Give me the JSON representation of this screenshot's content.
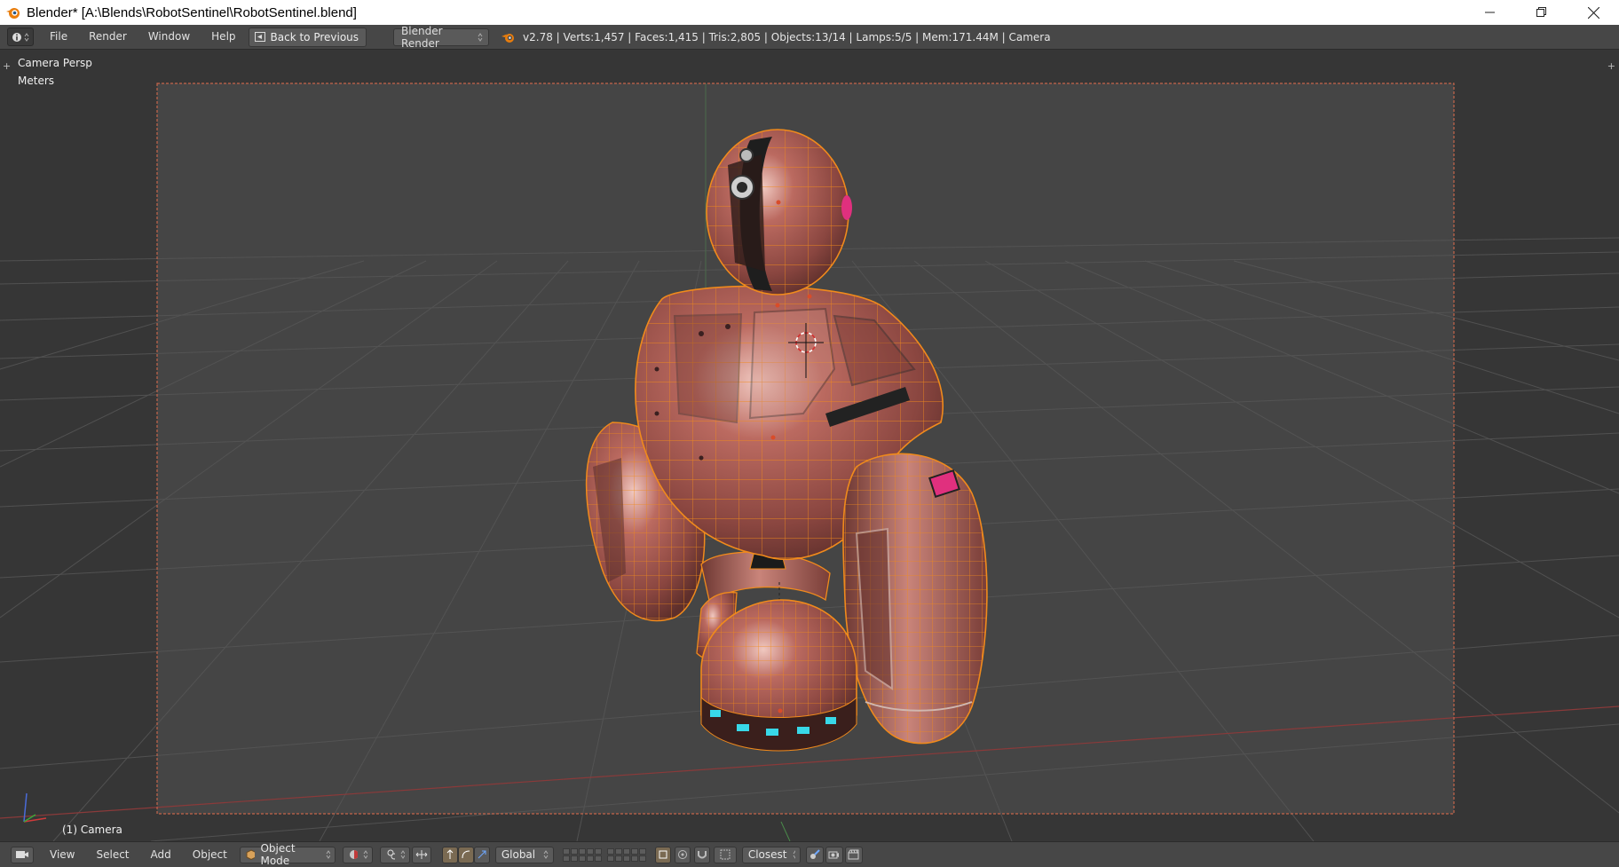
{
  "window": {
    "title": "Blender* [A:\\Blends\\RobotSentinel\\RobotSentinel.blend]",
    "controls": [
      "minimize",
      "restore",
      "close"
    ]
  },
  "info_header": {
    "menus": [
      "File",
      "Render",
      "Window",
      "Help"
    ],
    "back_button": "Back to Previous",
    "render_engine": "Blender Render",
    "stats": "v2.78 | Verts:1,457 | Faces:1,415 | Tris:2,805 | Objects:13/14 | Lamps:5/5 | Mem:171.44M | Camera"
  },
  "viewport": {
    "view_name": "Camera Persp",
    "units": "Meters",
    "active_object": "(1) Camera"
  },
  "view3d_header": {
    "menus": [
      "View",
      "Select",
      "Add",
      "Object"
    ],
    "mode": "Object Mode",
    "transform_orientation": "Global",
    "snap_target": "Closest"
  },
  "colors": {
    "background": "#393939",
    "robot_base": "#a8574e",
    "wire_selected": "#f08a1c",
    "camera_frame": "#c5654a",
    "accent_cyan": "#38d8e8",
    "accent_magenta": "#e0307e"
  }
}
